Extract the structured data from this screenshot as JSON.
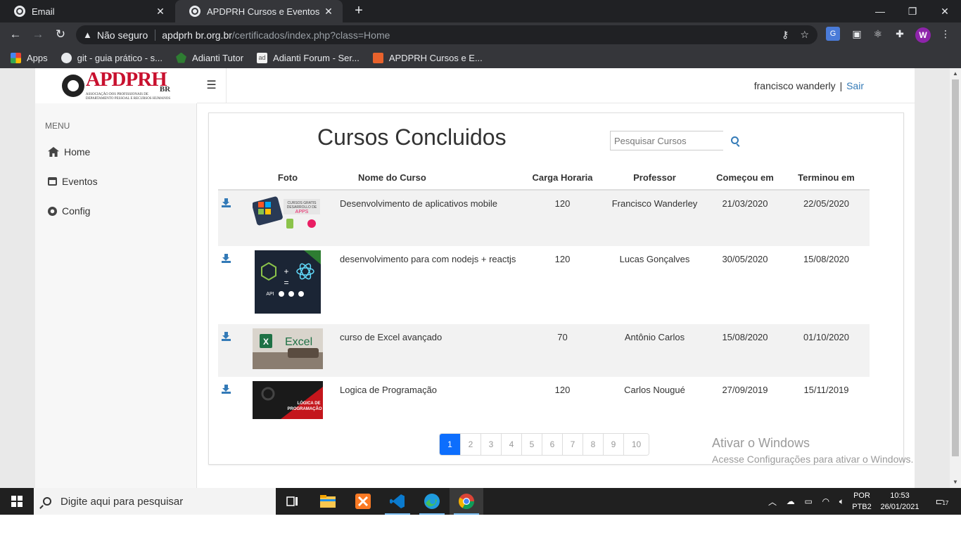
{
  "browser": {
    "tabs": [
      {
        "title": "Email",
        "active": false
      },
      {
        "title": "APDPRH Cursos e Eventos",
        "active": true
      }
    ],
    "address": {
      "security_label": "Não seguro",
      "host": "apdprh br.org.br",
      "path": "/certificados/index.php?class=Home"
    },
    "bookmarks": [
      {
        "label": "Apps",
        "icon": "apps-grid-icon"
      },
      {
        "label": "git - guia prático - s...",
        "icon": "globe-icon"
      },
      {
        "label": "Adianti Tutor",
        "icon": "adianti-leaf-icon"
      },
      {
        "label": "Adianti Forum - Ser...",
        "icon": "adianti-forum-icon"
      },
      {
        "label": "APDPRH Cursos e E...",
        "icon": "apdprh-favicon-icon"
      }
    ],
    "profile_initial": "W",
    "profile_color": "#8e24aa"
  },
  "app": {
    "logo": {
      "brand": "APDPRH",
      "suffix": "BR",
      "subtitle_line1": "ASSOCIAÇÃO DOS PROFISSIONAIS DE",
      "subtitle_line2": "DEPARTAMENTO PESSOAL E RECURSOS HUMANOS"
    },
    "menu": {
      "title": "MENU",
      "items": [
        {
          "label": "Home",
          "icon": "home-icon"
        },
        {
          "label": "Eventos",
          "icon": "calendar-icon"
        },
        {
          "label": "Config",
          "icon": "gear-icon"
        }
      ]
    },
    "user": {
      "name": "francisco wanderly",
      "separator": "|",
      "logout": "Sair"
    },
    "link_color": "#337ab7"
  },
  "courses": {
    "title": "Cursos Concluidos",
    "search_placeholder": "Pesquisar Cursos",
    "columns": [
      "Foto",
      "Nome do Curso",
      "Carga Horaria",
      "Professor",
      "Começou em",
      "Terminou em"
    ],
    "rows": [
      {
        "name": "Desenvolvimento de aplicativos mobile",
        "hours": "120",
        "teacher": "Francisco Wanderley",
        "start": "21/03/2020",
        "end": "22/05/2020",
        "thumb_caption": [
          "CURSOS GRATIS",
          "DESARROLLO DE",
          "APPS"
        ]
      },
      {
        "name": "desenvolvimento para com nodejs + reactjs",
        "hours": "120",
        "teacher": "Lucas Gonçalves",
        "start": "30/05/2020",
        "end": "15/08/2020",
        "thumb_caption": [
          "API"
        ]
      },
      {
        "name": "curso de Excel avançado",
        "hours": "70",
        "teacher": "Antônio Carlos",
        "start": "15/08/2020",
        "end": "01/10/2020",
        "thumb_caption": [
          "Excel"
        ]
      },
      {
        "name": "Logica de Programação",
        "hours": "120",
        "teacher": "Carlos Nougué",
        "start": "27/09/2019",
        "end": "15/11/2019",
        "thumb_caption": [
          "LÓGICA DE",
          "PROGRAMAÇÃO"
        ]
      }
    ],
    "pagination": {
      "pages": [
        "1",
        "2",
        "3",
        "4",
        "5",
        "6",
        "7",
        "8",
        "9",
        "10"
      ],
      "current": "1"
    }
  },
  "windows": {
    "activation_title": "Ativar o Windows",
    "activation_sub": "Acesse Configurações para ativar o Windows.",
    "search_placeholder": "Digite aqui para pesquisar",
    "lang_line1": "POR",
    "lang_line2": "PTB2",
    "time": "10:53",
    "date": "26/01/2021",
    "notifications": "17"
  }
}
